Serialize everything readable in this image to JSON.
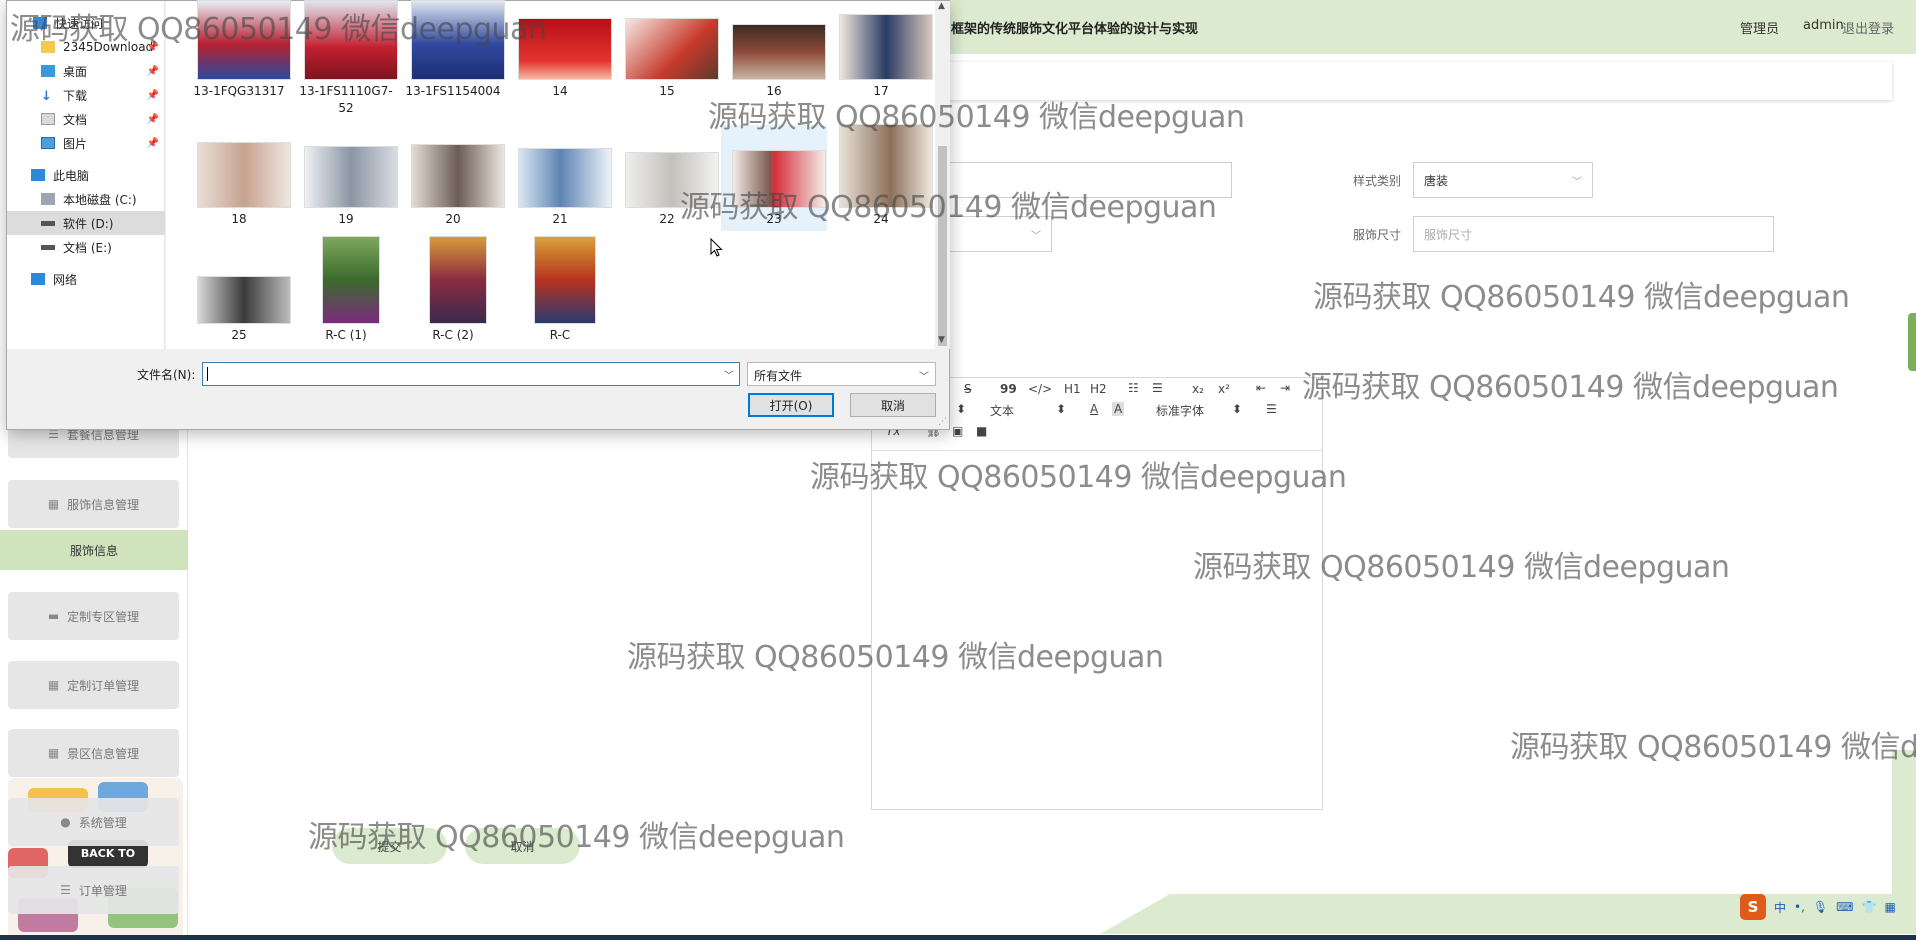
{
  "app": {
    "title": "框架的传统服饰文化平台体验的设计与实现",
    "user_role": "管理员",
    "user_name": "admin",
    "logout": "退出登录"
  },
  "sidebar": {
    "menu": [
      {
        "label": "套餐信息管理",
        "icon": "list-icon"
      },
      {
        "label": "服饰信息管理",
        "icon": "grid-icon"
      },
      {
        "label": "定制专区管理",
        "icon": "monitor-icon"
      },
      {
        "label": "定制订单管理",
        "icon": "grid-icon"
      },
      {
        "label": "景区信息管理",
        "icon": "grid-icon"
      },
      {
        "label": "系统管理",
        "icon": "pin-icon"
      },
      {
        "label": "订单管理",
        "icon": "list-icon"
      }
    ],
    "active_submenu": "服饰信息",
    "deco_text": "BACK TO"
  },
  "form": {
    "style_category_label": "样式类别",
    "style_category_value": "唐装",
    "size_label": "服饰尺寸",
    "size_placeholder": "服饰尺寸"
  },
  "editor": {
    "toolbar": {
      "strike": "S",
      "quote": "99",
      "code": "</>",
      "h1": "H1",
      "h2": "H2",
      "sub": "x₂",
      "sup": "x²",
      "text_style": "文本",
      "font_family": "标准字体",
      "clear": "Tx"
    }
  },
  "buttons": {
    "submit": "提交",
    "cancel": "取消"
  },
  "dialog": {
    "nav": [
      {
        "label": "快速访问",
        "pinned": false
      },
      {
        "label": "2345Download",
        "pinned": true
      },
      {
        "label": "桌面",
        "pinned": true
      },
      {
        "label": "下载",
        "pinned": true
      },
      {
        "label": "文档",
        "pinned": true
      },
      {
        "label": "图片",
        "pinned": true
      },
      {
        "label": "此电脑",
        "pinned": false
      },
      {
        "label": "本地磁盘 (C:)",
        "pinned": false
      },
      {
        "label": "软件 (D:)",
        "pinned": false
      },
      {
        "label": "文档 (E:)",
        "pinned": false
      },
      {
        "label": "网络",
        "pinned": false
      }
    ],
    "files": [
      {
        "name": "13-1FQG31317"
      },
      {
        "name": "13-1FS1110G7-52"
      },
      {
        "name": "13-1FS1154004"
      },
      {
        "name": "14"
      },
      {
        "name": "15"
      },
      {
        "name": "16"
      },
      {
        "name": "17"
      },
      {
        "name": "18"
      },
      {
        "name": "19"
      },
      {
        "name": "20"
      },
      {
        "name": "21"
      },
      {
        "name": "22"
      },
      {
        "name": "23"
      },
      {
        "name": "24"
      },
      {
        "name": "25"
      },
      {
        "name": "R-C (1)"
      },
      {
        "name": "R-C (2)"
      },
      {
        "name": "R-C"
      }
    ],
    "filename_label": "文件名(N):",
    "filename_value": "",
    "filter": "所有文件",
    "open_button": "打开(O)",
    "cancel_button": "取消"
  },
  "tray": {
    "ime_logo": "S",
    "ime_lang": "中"
  },
  "watermark": "源码获取 QQ86050149 微信deepguan",
  "colors": {
    "accent_green": "#dcebcf",
    "active_green": "#cfe4bd",
    "dialog_bg": "#f0f0f0",
    "selection": "#e5f1fb",
    "primary_blue": "#0078d7"
  }
}
